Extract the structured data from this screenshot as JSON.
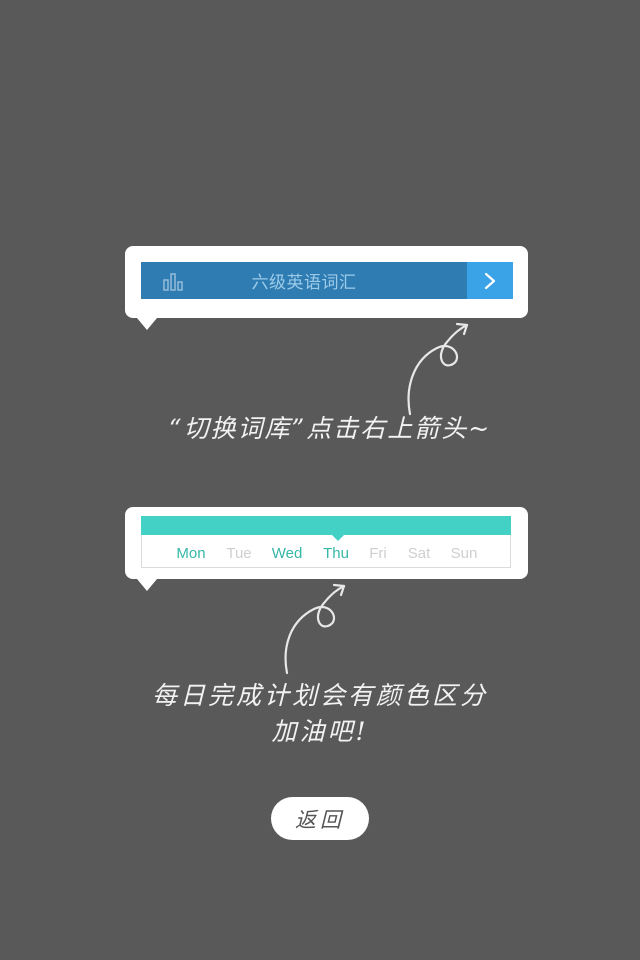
{
  "wordbook": {
    "title": "六级英语词汇",
    "stats_icon": "bar-chart-icon",
    "next_icon": "chevron-right-icon"
  },
  "hint_switch": {
    "text": "“切换词库”点击右上箭头~"
  },
  "week": {
    "days": [
      {
        "label": "Mon",
        "done": true
      },
      {
        "label": "Tue",
        "done": false
      },
      {
        "label": "Wed",
        "done": true
      },
      {
        "label": "Thu",
        "done": true,
        "today": true
      },
      {
        "label": "Fri",
        "done": false
      },
      {
        "label": "Sat",
        "done": false
      },
      {
        "label": "Sun",
        "done": false
      }
    ]
  },
  "hint_plan": {
    "line1": "每日完成计划会有颜色区分",
    "line2": "加油吧!"
  },
  "back_label": "返回",
  "colors": {
    "background": "#595959",
    "wordbook_bar": "#2f7cb3",
    "next_button": "#3aa2e6",
    "week_band": "#43d1c6",
    "day_done": "#35b7a6",
    "day_pending": "#cfcfcf"
  }
}
